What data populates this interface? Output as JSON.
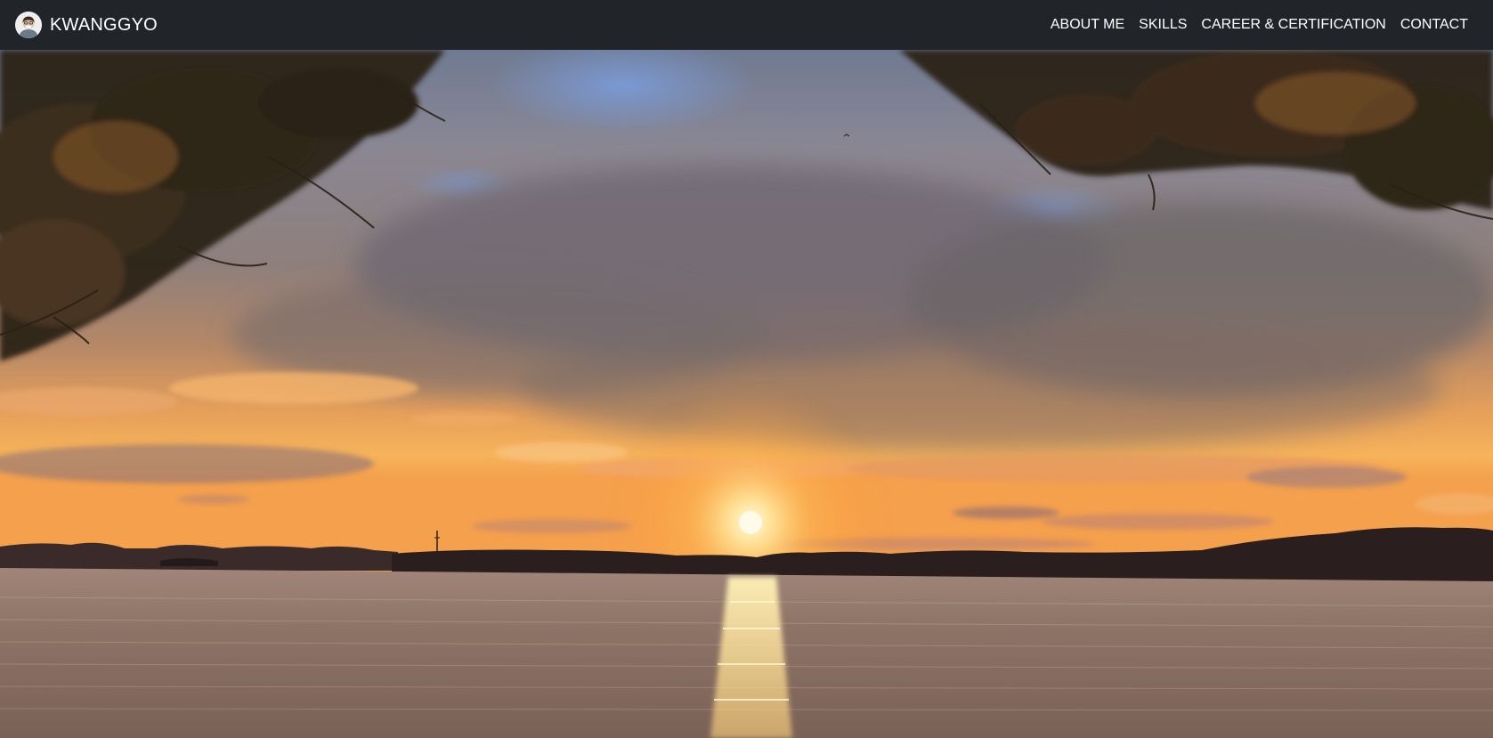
{
  "brand": {
    "name": "KWANGGYO",
    "avatar_icon": "profile-avatar-icon"
  },
  "nav": {
    "items": [
      {
        "label": "ABOUT ME"
      },
      {
        "label": "SKILLS"
      },
      {
        "label": "CAREER & CERTIFICATION"
      },
      {
        "label": "CONTACT"
      }
    ]
  },
  "hero": {
    "image_subject": "sunset-over-lake"
  },
  "colors": {
    "navbar_bg": "#212529",
    "nav_text": "#ffffff"
  }
}
